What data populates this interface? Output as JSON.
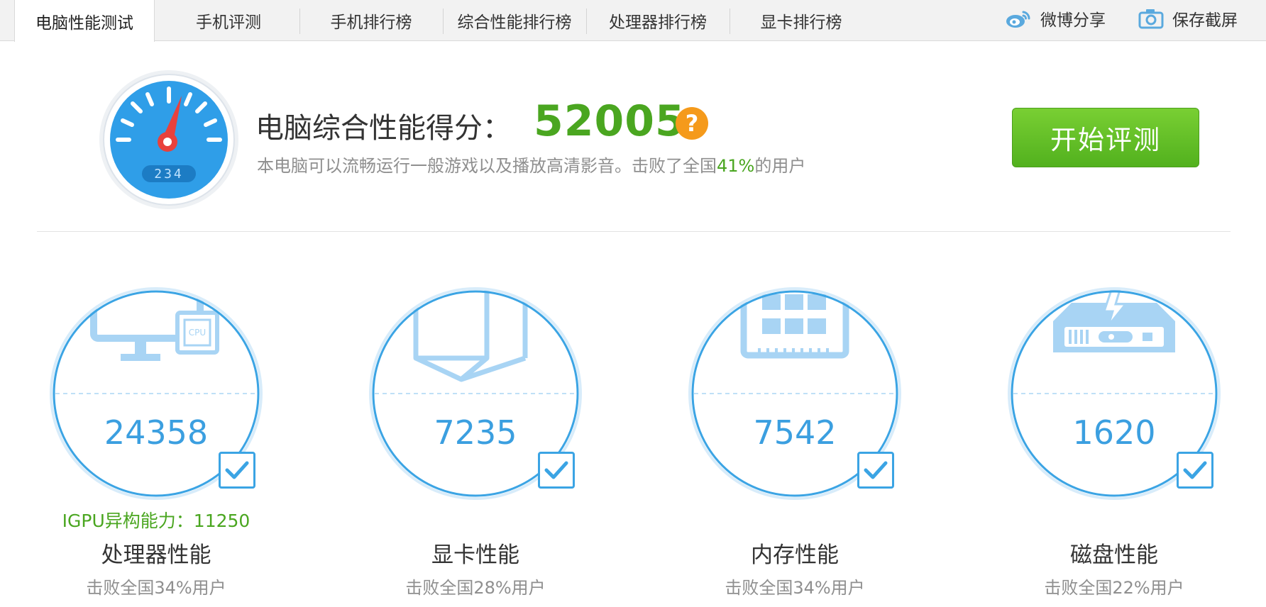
{
  "tabs": [
    {
      "label": "电脑性能测试",
      "active": true
    },
    {
      "label": "手机评测"
    },
    {
      "label": "手机排行榜"
    },
    {
      "label": "综合性能排行榜"
    },
    {
      "label": "处理器排行榜"
    },
    {
      "label": "显卡排行榜"
    }
  ],
  "tools": {
    "weibo_share": "微博分享",
    "save_screenshot": "保存截屏"
  },
  "gauge": {
    "reading": "234"
  },
  "score": {
    "title": "电脑综合性能得分：",
    "value": "52005",
    "help": "?",
    "desc_prefix": "本电脑可以流畅运行一般游戏以及播放高清影音。击败了全国",
    "desc_percent": "41%",
    "desc_suffix": "的用户"
  },
  "start_button": "开始评测",
  "metrics": [
    {
      "icon": "cpu-monitor-icon",
      "value": "24358",
      "extra": "IGPU异构能力：11250",
      "name": "处理器性能",
      "sub": "击败全国34%用户",
      "checked": true
    },
    {
      "icon": "gpu-cube-icon",
      "value": "7235",
      "name": "显卡性能",
      "sub": "击败全国28%用户",
      "checked": true
    },
    {
      "icon": "memory-chip-icon",
      "value": "7542",
      "name": "内存性能",
      "sub": "击败全国34%用户",
      "checked": true
    },
    {
      "icon": "disk-drive-icon",
      "value": "1620",
      "name": "磁盘性能",
      "sub": "击败全国22%用户",
      "checked": true
    }
  ],
  "colors": {
    "accent_blue": "#3ba4e4",
    "score_green": "#4aa620",
    "button_green": "#5cb82a",
    "help_orange": "#f59a1b",
    "muted_text": "#8f8f8f"
  }
}
